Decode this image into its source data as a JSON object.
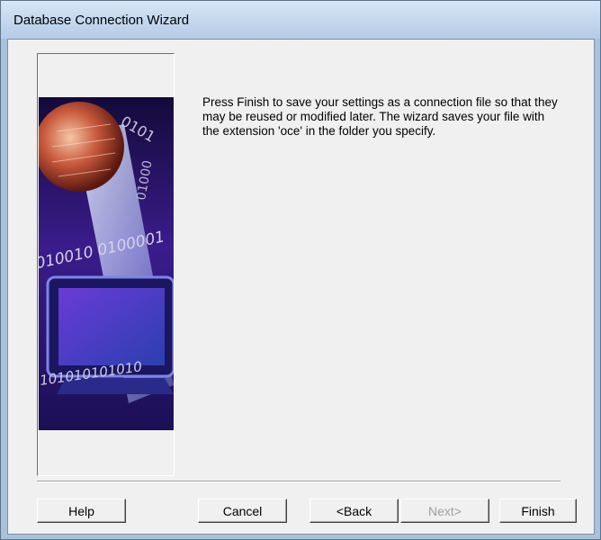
{
  "window": {
    "title": "Database Connection Wizard"
  },
  "message": {
    "text": "Press Finish to save your settings as a connection file so that they may be reused or modified later. The wizard saves your file with the extension 'oce' in the folder you specify."
  },
  "illustration": {
    "sphere_binary": "0101",
    "band_binary": "010010 0100001",
    "arc_binary": "01000",
    "bottom_binary": "101010101010"
  },
  "buttons": {
    "help": "Help",
    "cancel": "Cancel",
    "back": "<Back",
    "next": "Next>",
    "next_enabled": false,
    "finish": "Finish"
  }
}
